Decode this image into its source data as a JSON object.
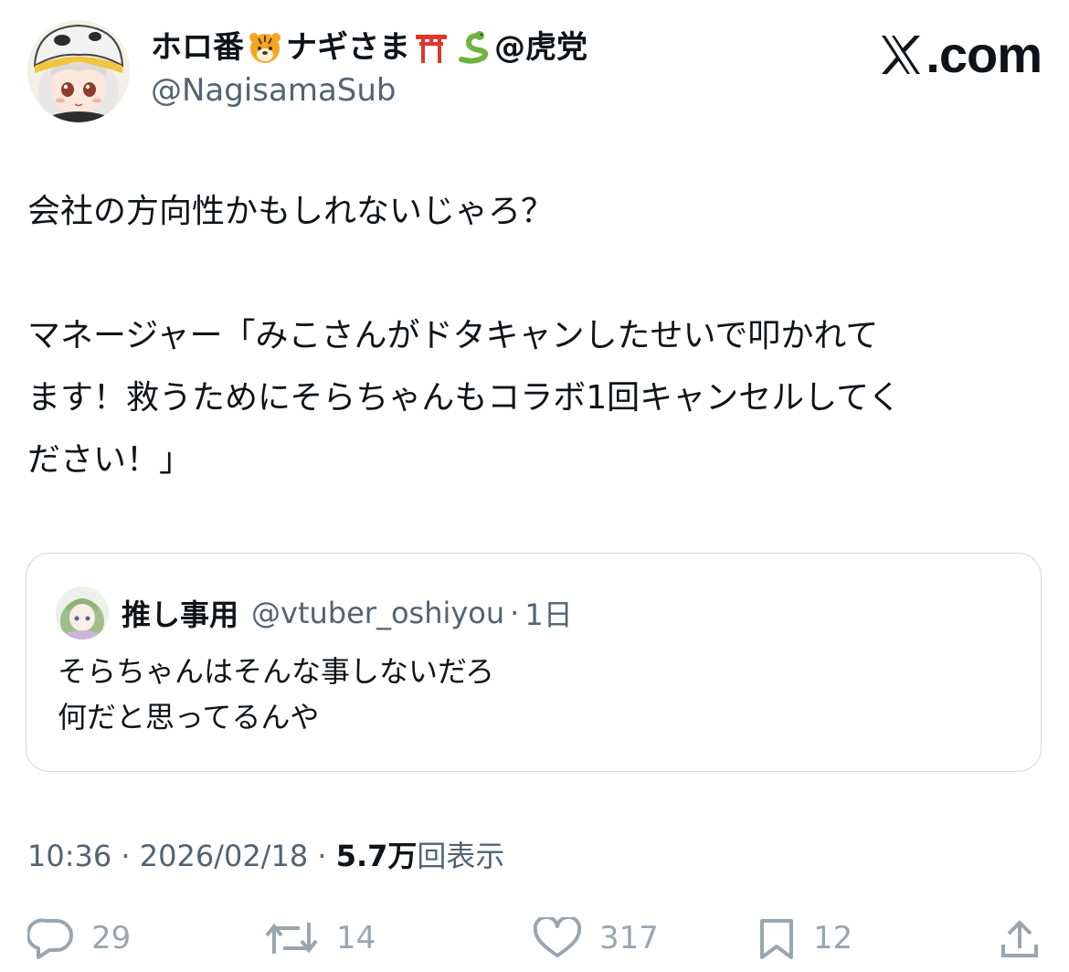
{
  "header": {
    "display_name_parts": [
      "ホロ番",
      "ナギさま",
      "@虎党"
    ],
    "handle": "@NagisamaSub",
    "brand": "com",
    "brand_prefix": "X"
  },
  "tweet": {
    "text": "会社の方向性かもしれないじゃろ？\n\nマネージャー「みこさんがドタキャンしたせいで叩かれて\nます！救うためにそらちゃんもコラボ1回キャンセルしてく\nださい！」"
  },
  "quote": {
    "name": "推し事用",
    "handle": "@vtuber_oshiyou",
    "separator": "·",
    "time": "1日",
    "text": "そらちゃんはそんな事しないだろ\n何だと思ってるんや"
  },
  "meta": {
    "time": "10:36",
    "sep1": " · ",
    "date": "2026/02/18",
    "sep2": " · ",
    "views_count": "5.7万",
    "views_label": "回表示"
  },
  "actions": {
    "replies": "29",
    "reposts": "14",
    "likes": "317",
    "bookmarks": "12"
  },
  "icons": {
    "emoji_1": "tiger-face-icon",
    "emoji_2": "torii-gate-icon",
    "emoji_3": "snake-icon",
    "reply": "reply-icon",
    "repost": "repost-icon",
    "like": "heart-icon",
    "bookmark": "bookmark-icon",
    "share": "share-icon"
  },
  "colors": {
    "text": "#0f1419",
    "secondary": "#536471",
    "border": "#cfd9de",
    "action_icons": "#9aa6ae"
  }
}
